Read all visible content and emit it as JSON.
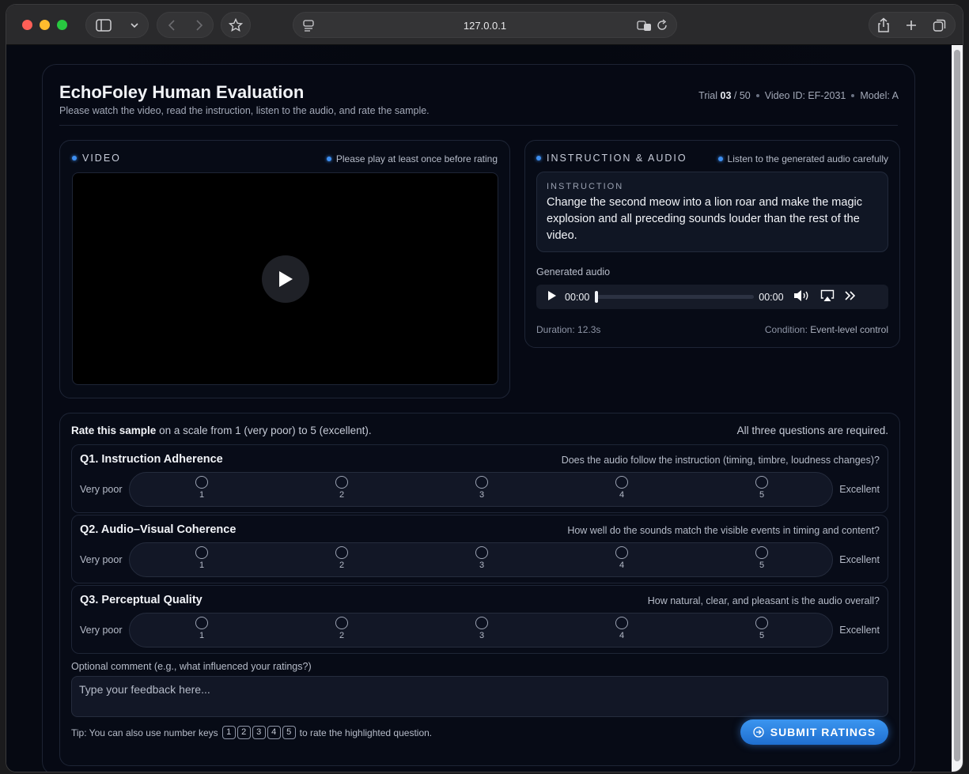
{
  "browser": {
    "url": "127.0.0.1"
  },
  "header": {
    "title": "EchoFoley Human Evaluation",
    "subtitle": "Please watch the video, read the instruction, listen to the audio, and rate the sample.",
    "trial_label": "Trial",
    "trial_current": "03",
    "trial_total": "/ 50",
    "video_id": "Video ID: EF-2031",
    "model": "Model: A"
  },
  "video_panel": {
    "label": "VIDEO",
    "hint": "Please play at least once before rating"
  },
  "audio_panel": {
    "label": "INSTRUCTION & AUDIO",
    "hint": "Listen to the generated audio carefully",
    "instruction_label": "INSTRUCTION",
    "instruction_text": "Change the second meow into a lion roar and make the magic explosion and all preceding sounds louder than the rest of the video.",
    "generated_label": "Generated audio",
    "time_current": "00:00",
    "time_total": "00:00",
    "duration": "Duration: 12.3s",
    "condition_label": "Condition:",
    "condition_value": "Event-level control"
  },
  "rating": {
    "head_bold": "Rate this sample",
    "head_rest": "on a scale from 1 (very poor) to 5 (excellent).",
    "required": "All three questions are required.",
    "low_label": "Very poor",
    "high_label": "Excellent",
    "options": [
      "1",
      "2",
      "3",
      "4",
      "5"
    ],
    "questions": [
      {
        "title": "Q1. Instruction Adherence",
        "desc": "Does the audio follow the instruction (timing, timbre, loudness changes)?"
      },
      {
        "title": "Q2. Audio–Visual Coherence",
        "desc": "How well do the sounds match the visible events in timing and content?"
      },
      {
        "title": "Q3. Perceptual Quality",
        "desc": "How natural, clear, and pleasant is the audio overall?"
      }
    ]
  },
  "comment": {
    "label": "Optional comment (e.g., what influenced your ratings?)",
    "placeholder": "Type your feedback here..."
  },
  "footer": {
    "tip_prefix": "Tip: You can also use number keys",
    "tip_suffix": "to rate the highlighted question.",
    "submit_label": "SUBMIT RATINGS"
  },
  "colors": {
    "accent": "#3d8ef0",
    "background": "#060914"
  }
}
